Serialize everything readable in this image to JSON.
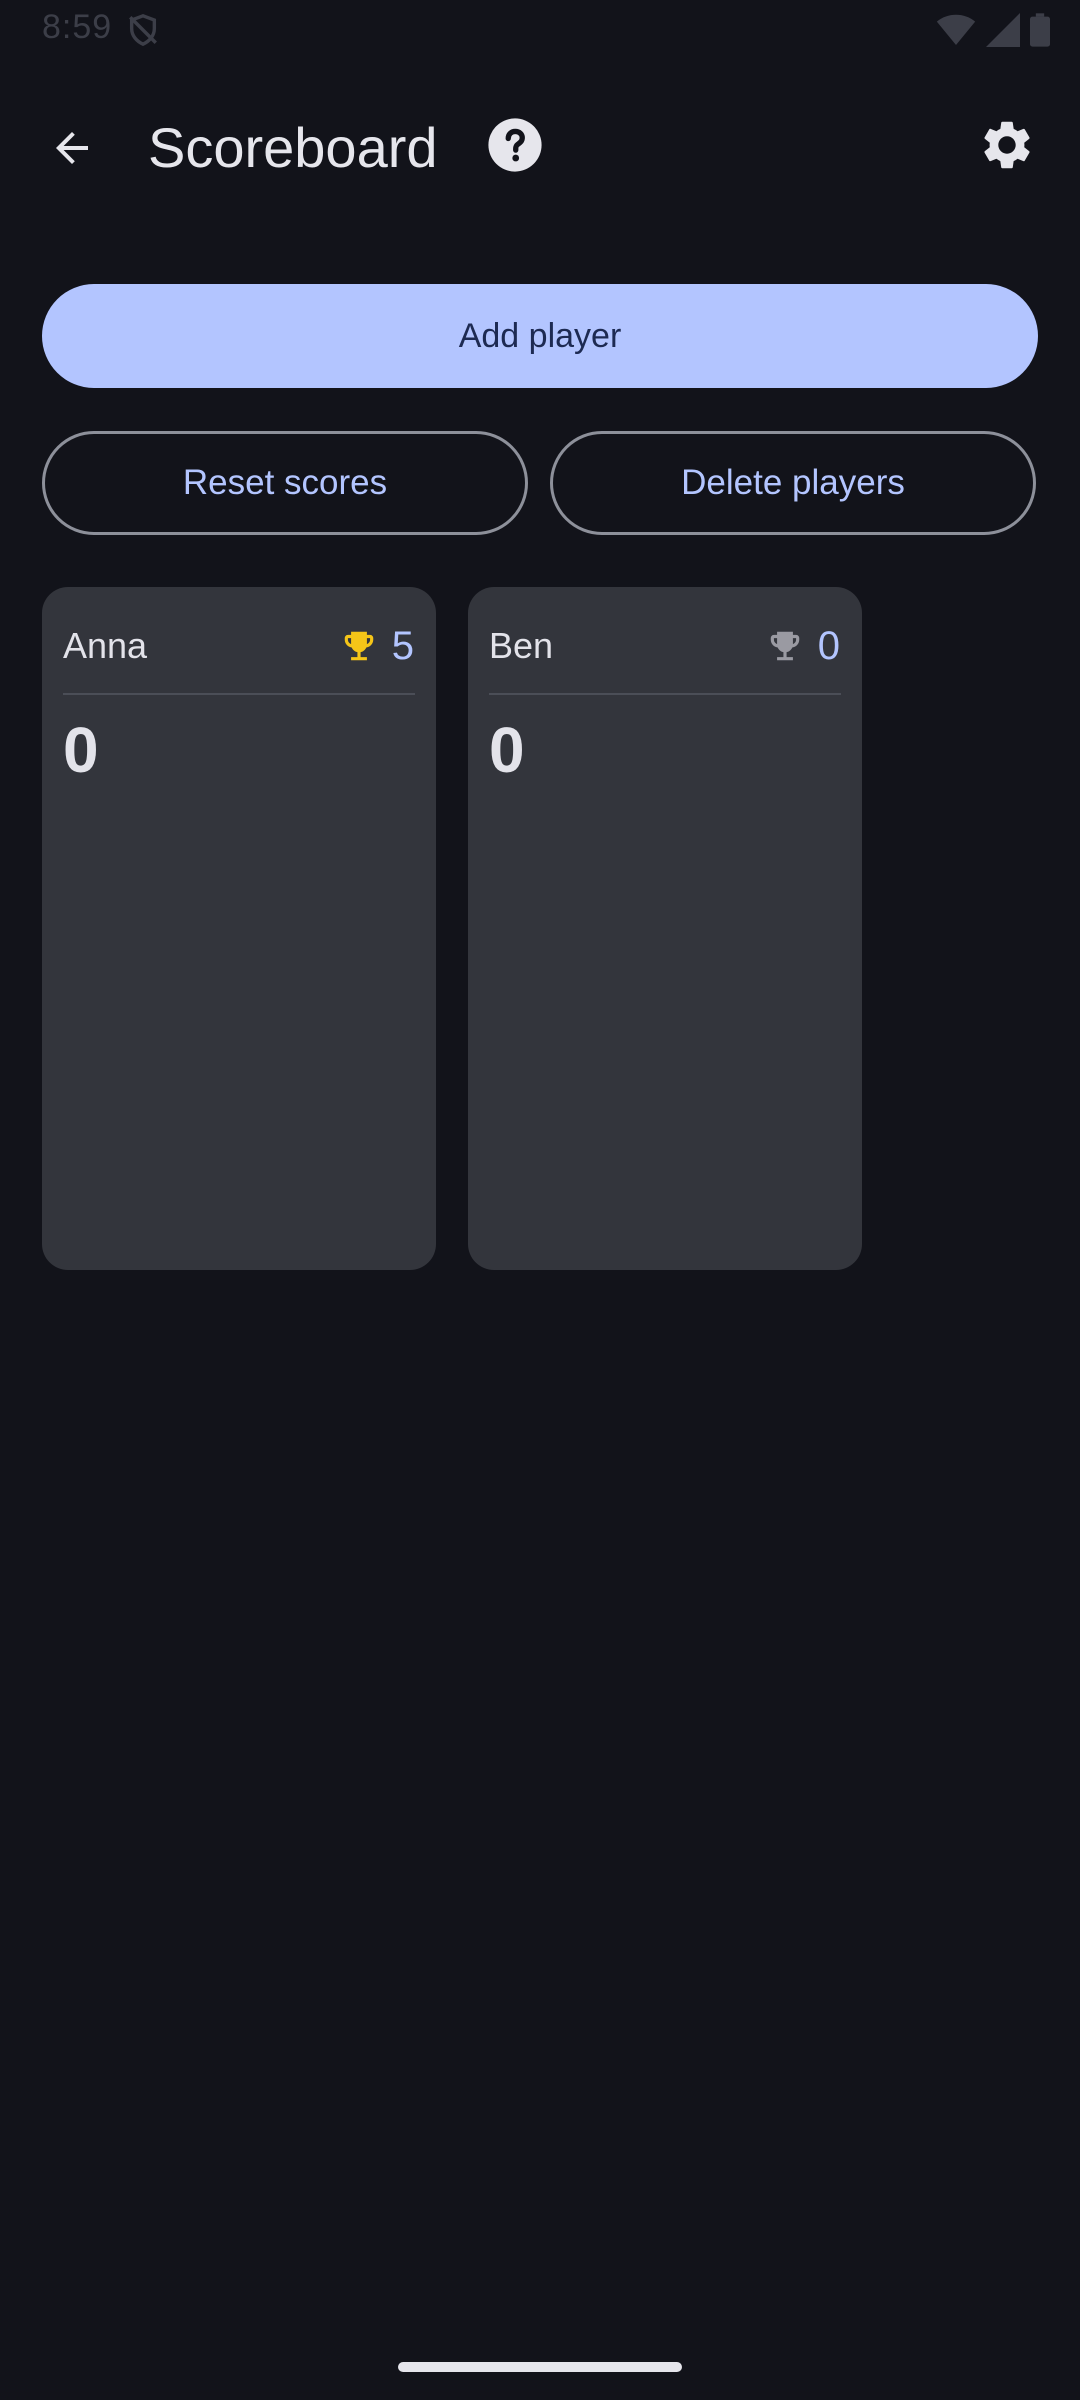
{
  "status_bar": {
    "time": "8:59"
  },
  "app_bar": {
    "title": "Scoreboard"
  },
  "actions": {
    "add_player": "Add player",
    "reset_scores": "Reset scores",
    "delete_players": "Delete players"
  },
  "players": [
    {
      "name": "Anna",
      "wins": "5",
      "score": "0",
      "trophy_color": "#f5c518"
    },
    {
      "name": "Ben",
      "wins": "0",
      "score": "0",
      "trophy_color": "#9a9aa2"
    }
  ],
  "icons": {
    "back": "arrow-left-icon",
    "help": "help-circle-icon",
    "settings": "gear-icon",
    "trophy": "trophy-icon"
  },
  "colors": {
    "background": "#12131a",
    "accent": "#b3c5ff",
    "card": "#33353c"
  }
}
